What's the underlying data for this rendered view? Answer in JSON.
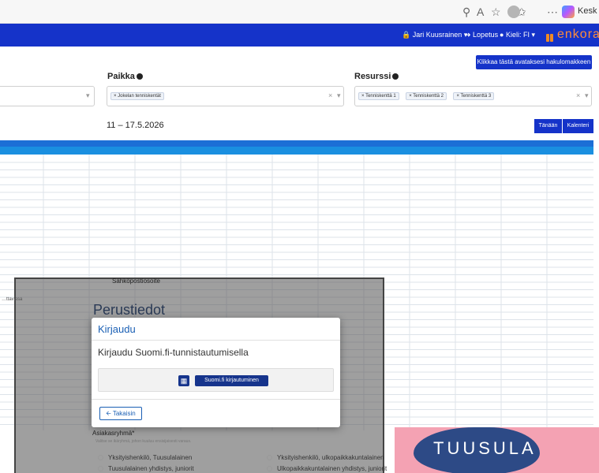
{
  "browser": {
    "profile_label": "Kesk"
  },
  "header": {
    "user": "Jari Kuusrainen",
    "logout": "Lopetus",
    "language": "Kieli: FI",
    "logo": "enkora"
  },
  "search": {
    "open_form_button": "Klikkaa tästä avataksesi hakulomakkeen",
    "location_label": "Paikka",
    "location_chip": "Jokelan tenniskentät",
    "resource_label": "Resurssi",
    "resource_chips": [
      "Tenniskenttä 1",
      "Tenniskenttä 2",
      "Tenniskenttä 3"
    ]
  },
  "calendar": {
    "date_range": "11 – 17.5.2026",
    "today_button": "Tänään",
    "calendar_button": "Kalenteri"
  },
  "background_form": {
    "email_label": "Sähköpostiosoite",
    "section_title": "Perustiedot",
    "customer_group_label": "Asiakasryhmä*",
    "customer_group_hint": "Valitse se ikäryhmä, johon kuuluu ensisijaisesti varaus.",
    "options": [
      "Yksityishenkilö, Tuusulalainen",
      "Yksityishenkilö, ulkopaikkakuntalainen",
      "Tuusulalainen yhdistys, juniorit",
      "Ulkopaikkakuntalainen yhdistys, juniorit"
    ]
  },
  "login_modal": {
    "title": "Kirjaudu",
    "subtitle": "Kirjaudu Suomi.fi-tunnistautumisella",
    "suomifi_button": "Suomi.fi kirjautuminen",
    "back_button": "Takaisin"
  },
  "banner": {
    "text": "TUUSULA"
  },
  "colors": {
    "header_blue": "#1533c9",
    "calendar_head": "#1a8fe0",
    "modal_title": "#1a5fb4",
    "logo_orange": "#ff8c3a",
    "banner_pink": "#f4a2b3",
    "banner_navy": "#2d4a86"
  }
}
